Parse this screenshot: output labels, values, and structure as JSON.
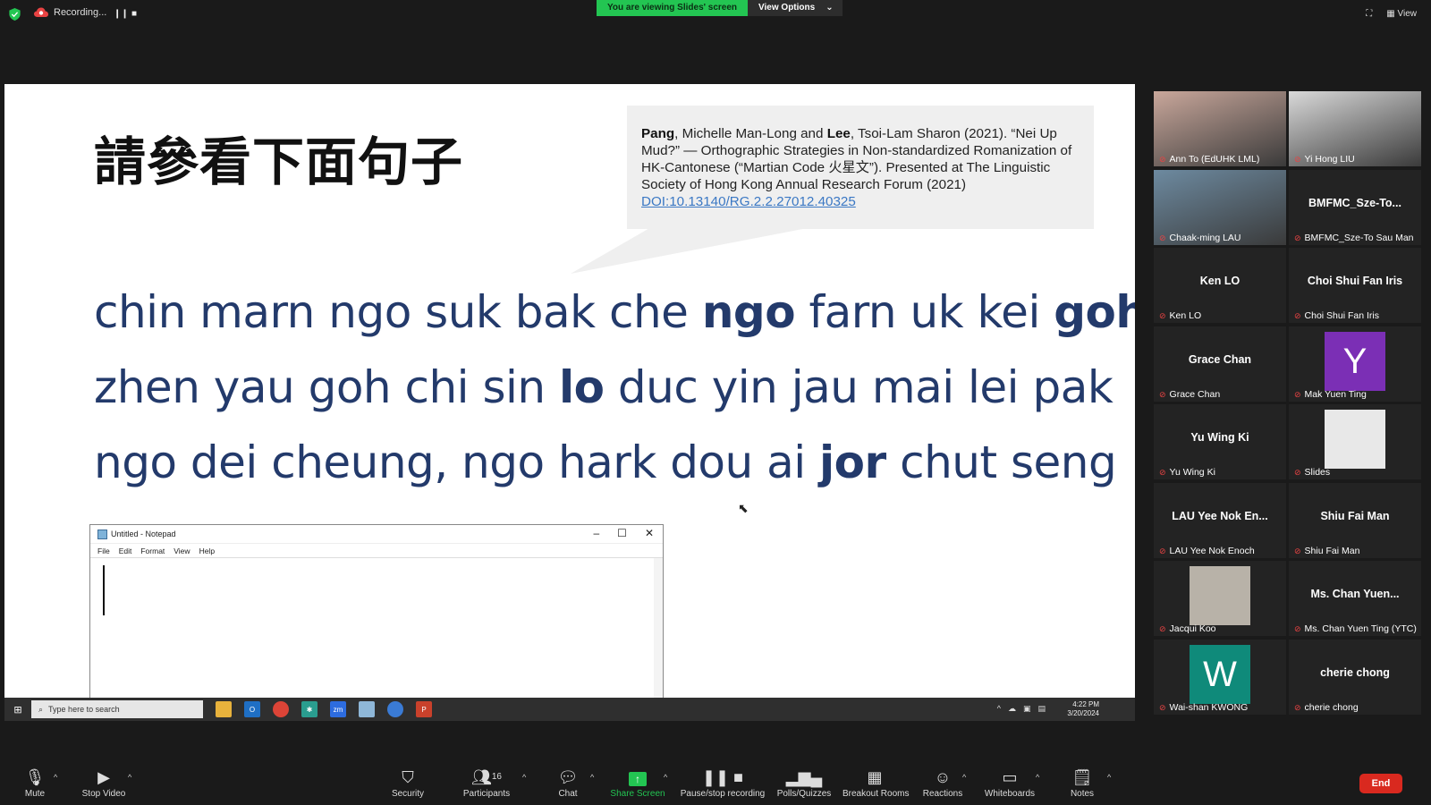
{
  "top_bar": {
    "recording_label": "Recording...",
    "pause_glyph": "❙❙",
    "stop_glyph": "■",
    "banner_text": "You are viewing Slides' screen",
    "view_options_label": "View Options",
    "view_label": "View"
  },
  "slide": {
    "title": "請參看下面句子",
    "citation": {
      "author1": "Pang",
      "part1": ", Michelle Man-Long and ",
      "author2": "Lee",
      "part2": ", Tsoi-Lam Sharon (2021). “Nei Up Mud?” — Orthographic Strategies in Non-standardized Romanization of HK-Cantonese (“Martian Code 火星文”). Presented at The Linguistic Society of Hong Kong Annual Research Forum (2021)",
      "doi": "DOI:10.13140/RG.2.2.27012.40325"
    },
    "line1": [
      {
        "t": "chin marn ngo suk bak che ",
        "b": false
      },
      {
        "t": "ngo",
        "b": true
      },
      {
        "t": " farn uk kei ",
        "b": false
      },
      {
        "t": "goh",
        "b": true
      }
    ],
    "line2": [
      {
        "t": "zhen yau goh chi sin ",
        "b": false
      },
      {
        "t": "lo",
        "b": true
      },
      {
        "t": " duc yin jau mai lei pak",
        "b": false
      }
    ],
    "line3": [
      {
        "t": "ngo dei cheung, ngo hark dou ai ",
        "b": false
      },
      {
        "t": "jor",
        "b": true
      },
      {
        "t": " chut seng",
        "b": false
      }
    ]
  },
  "notepad": {
    "title": "Untitled - Notepad",
    "menu": [
      "File",
      "Edit",
      "Format",
      "View",
      "Help"
    ]
  },
  "taskbar": {
    "search_placeholder": "Type here to search",
    "time": "4:22 PM",
    "date": "3/20/2024"
  },
  "participants": [
    {
      "display": "",
      "label": "Ann To (EdUHK LML)",
      "type": "photo",
      "color": "#c9a79b"
    },
    {
      "display": "",
      "label": "Yi Hong LIU",
      "type": "photo",
      "color": "#d9d9d9"
    },
    {
      "display": "",
      "label": "Chaak-ming LAU",
      "type": "photo",
      "color": "#6d8aa0",
      "active": true
    },
    {
      "display": "BMFMC_Sze-To...",
      "label": "BMFMC_Sze-To Sau Man",
      "type": "name"
    },
    {
      "display": "Ken LO",
      "label": "Ken LO",
      "type": "name"
    },
    {
      "display": "Choi Shui Fan Iris",
      "label": "Choi Shui Fan Iris",
      "type": "name"
    },
    {
      "display": "Grace Chan",
      "label": "Grace Chan",
      "type": "name"
    },
    {
      "display": "Y",
      "label": "Mak Yuen Ting",
      "type": "letter",
      "color": "#7b2fb5"
    },
    {
      "display": "Yu Wing Ki",
      "label": "Yu Wing Ki",
      "type": "name"
    },
    {
      "display": "",
      "label": "Slides",
      "type": "avatarphoto",
      "color": "#e8e8e8"
    },
    {
      "display": "LAU Yee Nok En...",
      "label": "LAU Yee Nok Enoch",
      "type": "name"
    },
    {
      "display": "Shiu Fai Man",
      "label": "Shiu Fai Man",
      "type": "name"
    },
    {
      "display": "",
      "label": "Jacqui Koo",
      "type": "avatarphoto",
      "color": "#b8b2a8"
    },
    {
      "display": "Ms. Chan Yuen...",
      "label": "Ms. Chan Yuen Ting (YTC)",
      "type": "name"
    },
    {
      "display": "W",
      "label": "Wai-shan KWONG",
      "type": "letter",
      "color": "#0f8a7a"
    },
    {
      "display": "cherie chong",
      "label": "cherie chong",
      "type": "name"
    }
  ],
  "toolbar": {
    "mute": "Mute",
    "stop_video": "Stop Video",
    "security": "Security",
    "participants": "Participants",
    "participants_count": "16",
    "chat": "Chat",
    "share_screen": "Share Screen",
    "pause_stop_recording": "Pause/stop recording",
    "polls": "Polls/Quizzes",
    "breakout": "Breakout Rooms",
    "reactions": "Reactions",
    "whiteboards": "Whiteboards",
    "notes": "Notes",
    "end": "End"
  }
}
